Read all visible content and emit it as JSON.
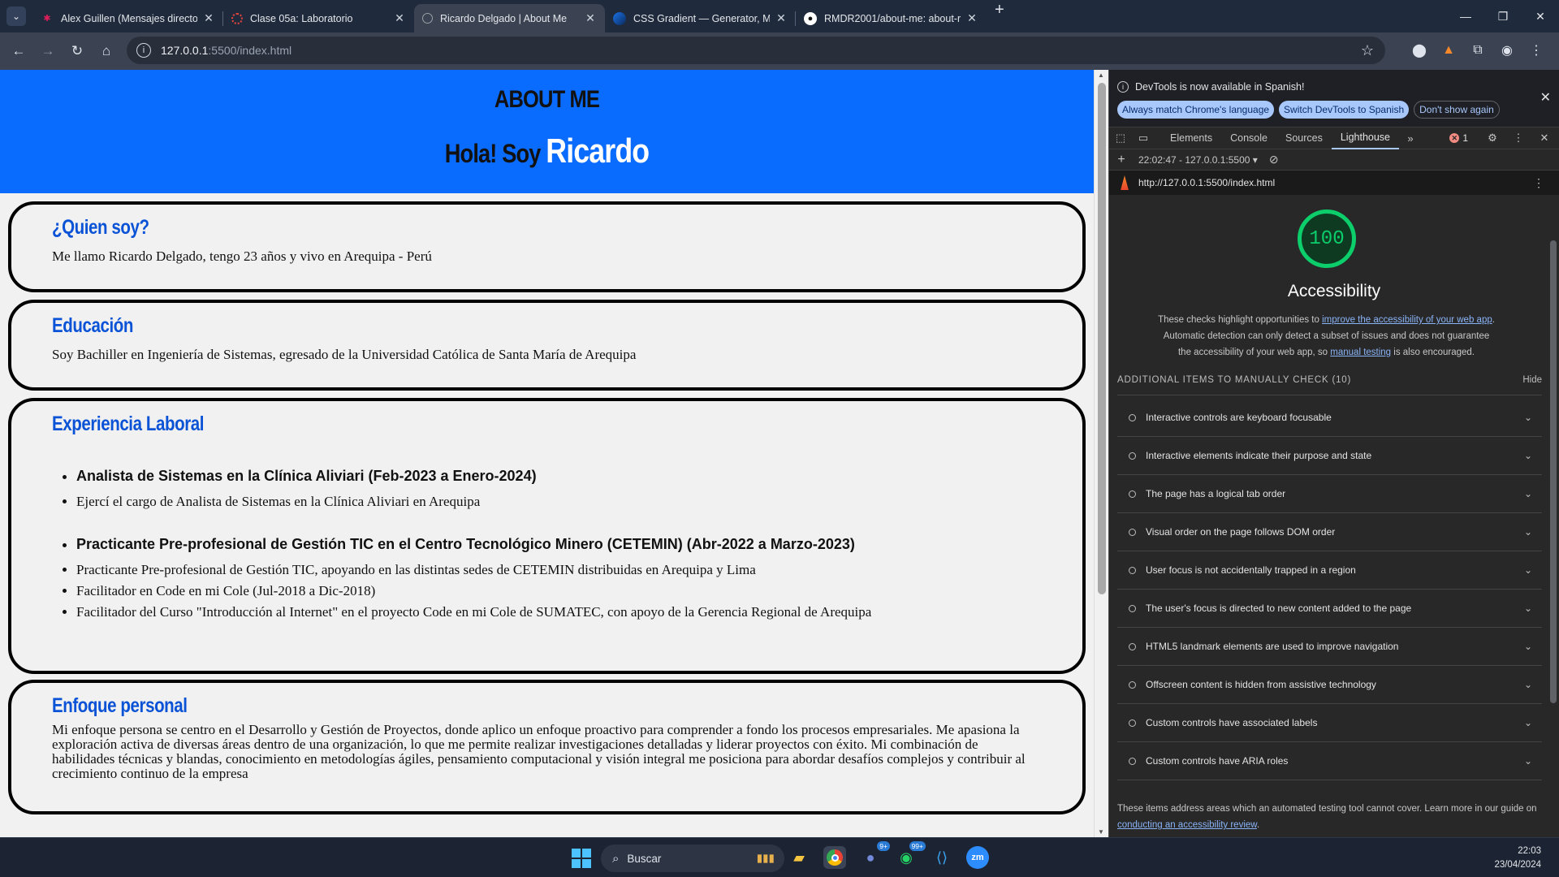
{
  "browser": {
    "tabs": [
      {
        "title": "Alex Guillen (Mensajes directo",
        "fav_icon": "slack-icon",
        "fav_color": "#e01e5a"
      },
      {
        "title": "Clase 05a: Laboratorio",
        "fav_icon": "loading-icon",
        "fav_color": "#e8453c"
      },
      {
        "title": "Ricardo Delgado | About Me",
        "fav_icon": "globe-icon",
        "fav_color": "#9aa0a6"
      },
      {
        "title": "CSS Gradient — Generator, Ma",
        "fav_icon": "gradient-icon",
        "fav_color": "#1a73e8"
      },
      {
        "title": "RMDR2001/about-me: about-r",
        "fav_icon": "github-icon",
        "fav_color": "#ffffff"
      }
    ],
    "active_tab": 2,
    "url_host": "127.0.0.1",
    "url_path": ":5500/index.html"
  },
  "page": {
    "title": "ABOUT ME",
    "greeting": "Hola! Soy",
    "name": "Ricardo",
    "sections": {
      "quien": {
        "heading": "¿Quien soy?",
        "text": "Me llamo Ricardo Delgado, tengo 23 años y vivo en Arequipa - Perú"
      },
      "educacion": {
        "heading": "Educación",
        "text": "Soy Bachiller en Ingeniería de Sistemas, egresado de la Universidad Católica de Santa María de Arequipa"
      },
      "experiencia": {
        "heading": "Experiencia Laboral",
        "job1": "Analista de Sistemas en la Clínica Aliviari (Feb-2023 a Enero-2024)",
        "job1_items": [
          "Ejercí el cargo de Analista de Sistemas en la Clínica Aliviari en Arequipa"
        ],
        "job2": "Practicante Pre-profesional de Gestión TIC en el Centro Tecnológico Minero (CETEMIN) (Abr-2022 a Marzo-2023)",
        "job2_items": [
          "Practicante Pre-profesional de Gestión TIC, apoyando en las distintas sedes de CETEMIN distribuidas en Arequipa y Lima",
          "Facilitador en Code en mi Cole (Jul-2018 a Dic-2018)",
          "Facilitador del Curso \"Introducción al Internet\" en el proyecto Code en mi Cole de SUMATEC, con apoyo de la Gerencia Regional de Arequipa"
        ]
      },
      "enfoque": {
        "heading": "Enfoque personal",
        "text": "Mi enfoque persona se centro en el Desarrollo y Gestión de Proyectos, donde aplico un enfoque proactivo para comprender a fondo los procesos empresariales. Me apasiona la exploración activa de diversas áreas dentro de una organización, lo que me permite realizar investigaciones detalladas y liderar proyectos con éxito. Mi combinación de habilidades técnicas y blandas, conocimiento en metodologías ágiles, pensamiento computacional y visión integral me posiciona para abordar desafíos complejos y contribuir al crecimiento continuo de la empresa"
      }
    }
  },
  "devtools": {
    "banner": {
      "message": "DevTools is now available in Spanish!",
      "btn_match": "Always match Chrome's language",
      "btn_switch": "Switch DevTools to Spanish",
      "btn_dismiss": "Don't show again"
    },
    "tabs": [
      "Elements",
      "Console",
      "Sources",
      "Lighthouse"
    ],
    "active_tab": "Lighthouse",
    "error_count": "1",
    "report_selector": "22:02:47 - 127.0.0.1:5500",
    "report_url": "http://127.0.0.1:5500/index.html",
    "lighthouse": {
      "score": "100",
      "score_color": "#0cce6b",
      "category": "Accessibility",
      "desc_1": "These checks highlight opportunities to ",
      "desc_link1": "improve the accessibility of your web app",
      "desc_2": ". Automatic detection can only detect a subset of issues and does not guarantee the accessibility of your web app, so ",
      "desc_link2": "manual testing",
      "desc_3": " is also encouraged.",
      "manual_header": "ADDITIONAL ITEMS TO MANUALLY CHECK (10)",
      "hide_label": "Hide",
      "audits": [
        "Interactive controls are keyboard focusable",
        "Interactive elements indicate their purpose and state",
        "The page has a logical tab order",
        "Visual order on the page follows DOM order",
        "User focus is not accidentally trapped in a region",
        "The user's focus is directed to new content added to the page",
        "HTML5 landmark elements are used to improve navigation",
        "Offscreen content is hidden from assistive technology",
        "Custom controls have associated labels",
        "Custom controls have ARIA roles"
      ],
      "footnote_1": "These items address areas which an automated testing tool cannot cover. Learn more in our guide on ",
      "footnote_link": "conducting an accessibility review",
      "footnote_2": "."
    }
  },
  "taskbar": {
    "search_placeholder": "Buscar",
    "discord_badge": "9+",
    "whatsapp_badge": "99+",
    "time": "22:03",
    "date": "23/04/2024"
  }
}
